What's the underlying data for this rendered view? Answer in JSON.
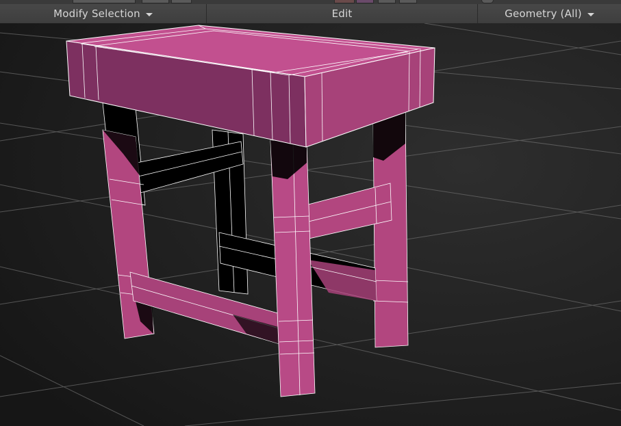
{
  "ribbon": {
    "panels": [
      {
        "label": "Modify Selection",
        "has_dropdown": true
      },
      {
        "label": "Edit",
        "has_dropdown": false
      },
      {
        "label": "Geometry (All)",
        "has_dropdown": true
      }
    ]
  },
  "viewport": {
    "object": "stool-mesh",
    "colors": {
      "background": "#1c1c1c",
      "grid_line": "#6a6a6a",
      "mesh_face_light": "#c2508f",
      "mesh_face_mid": "#a74279",
      "mesh_face_dark": "#7d3060",
      "edge_wire": "#ffffff",
      "shadow_face": "#000000",
      "ribbon_text": "#d6d6d6"
    }
  }
}
